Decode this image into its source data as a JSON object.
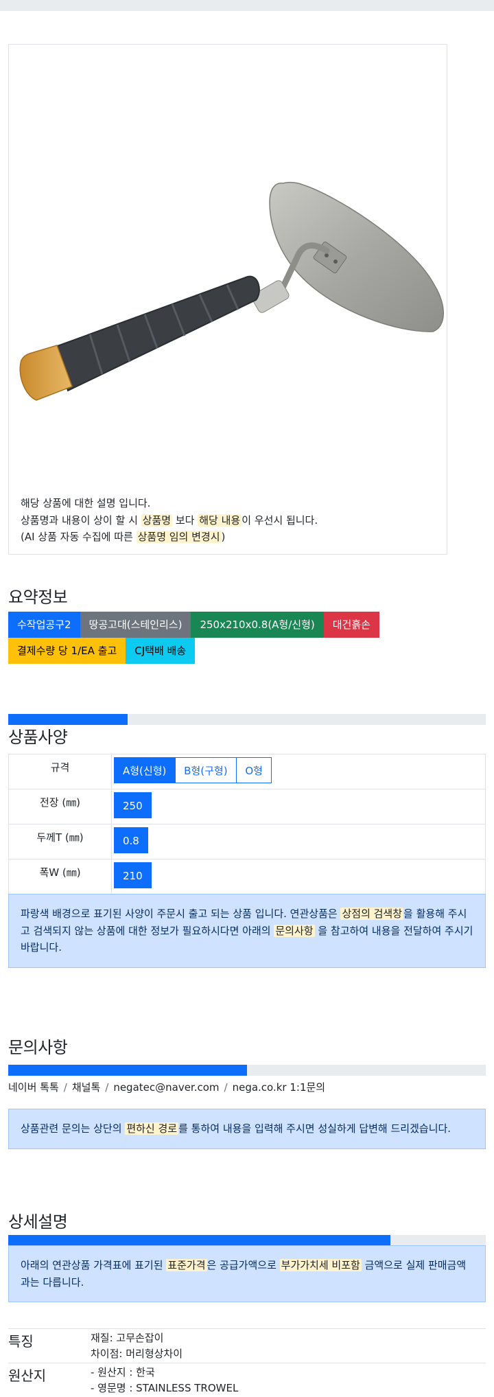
{
  "product": {
    "description": {
      "line1": "해당 상품에 대한 설명 입니다.",
      "line2_pre": "상품명과 내용이 상이 할 시",
      "line2_mark1": "상품명",
      "line2_mid": "보다",
      "line2_mark2": "해당 내용",
      "line2_post": "이 우선시 됩니다.",
      "line3_pre": "(AI 상품 자동 수집에 따른",
      "line3_mark": "상품명 임의 변경시",
      "line3_post": ")"
    }
  },
  "summary": {
    "title": "요약정보",
    "badges": [
      "수작업공구2",
      "땅공고대(스테인리스)",
      "250x210x0.8(A형/신형)",
      "대건흙손",
      "결제수량 당 1/EA 출고",
      "CJ택배 배송"
    ]
  },
  "spec": {
    "title": "상품사양",
    "progress_pct": 25,
    "rows": [
      {
        "label": "규격",
        "options": [
          "A형(신형)",
          "B형(구형)",
          "O형"
        ],
        "selected": 0
      },
      {
        "label": "전장 (㎜)",
        "options": [
          "250"
        ],
        "selected": 0
      },
      {
        "label": "두께T (㎜)",
        "options": [
          "0.8"
        ],
        "selected": 0
      },
      {
        "label": "폭W (㎜)",
        "options": [
          "210"
        ],
        "selected": 0
      }
    ],
    "notice": {
      "pre": "파랑색 배경으로 표기된 사양이 주문시 출고 되는 상품 입니다. 연관상품은",
      "mark1": "상점의 검색창",
      "mid": "을 활용해 주시고 검색되지 않는 상품에 대한 정보가 필요하시다면 아래의",
      "mark2": "문의사항",
      "post": "을 참고하여 내용을 전달하여 주시기 바랍니다."
    }
  },
  "inquiry": {
    "title": "문의사항",
    "progress_pct": 50,
    "links": [
      "네이버 톡톡",
      "채널톡",
      "negatec@naver.com",
      "nega.co.kr 1:1문의"
    ],
    "separator": "/",
    "notice": {
      "pre": "상품관련 문의는 상단의",
      "mark": "편하신 경로",
      "post": "를 통하여 내용을 입력해 주시면 성실하게 답변해 드리겠습니다."
    }
  },
  "detail": {
    "title": "상세설명",
    "progress_pct": 80,
    "notice": {
      "pre": "아래의 연관상품 가격표에 표기된",
      "mark1": "표준가격",
      "mid": "은 공급가액으로",
      "mark2": "부가가치세 비포함",
      "post": "금액으로 실제 판매금액과는 다릅니다."
    },
    "features": [
      {
        "key": "특징",
        "values": [
          "재질: 고무손잡이",
          "차이점: 머리형상차이"
        ]
      },
      {
        "key": "원산지",
        "values": [
          "- 원산지 : 한국",
          "- 영문명 : STAINLESS TROWEL"
        ]
      }
    ]
  },
  "colors": {
    "primary": "#0d6efd",
    "secondary": "#6c757d",
    "success": "#198754",
    "danger": "#dc3545",
    "warning": "#ffc107",
    "info": "#0dcaf0",
    "alert_bg": "#cfe2ff",
    "highlight": "#fff3cd"
  }
}
